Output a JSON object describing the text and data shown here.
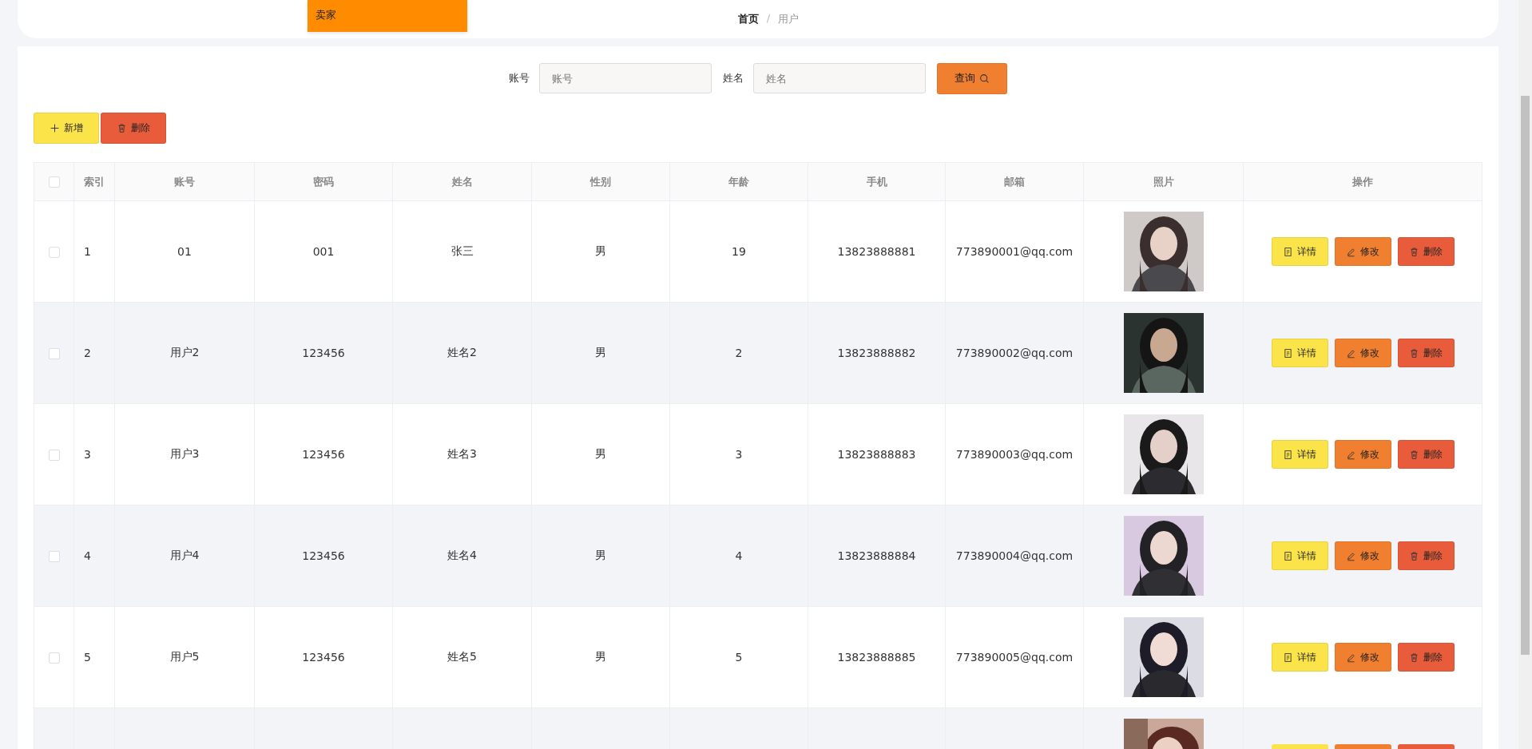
{
  "header": {
    "role_menu": {
      "label": "卖家"
    },
    "breadcrumb": [
      {
        "label": "首页",
        "current": false
      },
      {
        "label": "用户",
        "current": true
      }
    ],
    "separator": "/"
  },
  "search": {
    "fields": [
      {
        "label": "账号",
        "placeholder": "账号"
      },
      {
        "label": "姓名",
        "placeholder": "姓名"
      }
    ],
    "button": "查询"
  },
  "toolbar": [
    {
      "label": "新增",
      "kind": "add"
    },
    {
      "label": "删除",
      "kind": "delete"
    }
  ],
  "table": {
    "select_all": {
      "checked": false
    },
    "columns": [
      "索引",
      "账号",
      "密码",
      "姓名",
      "性别",
      "年龄",
      "手机",
      "邮箱",
      "照片",
      "操作"
    ],
    "rows": [
      {
        "checked": false,
        "cells": [
          "1",
          "01",
          "001",
          "张三",
          "男",
          "19",
          "13823888881",
          "773890001@qq.com"
        ],
        "actions": [
          {
            "label": "详情",
            "kind": "detail"
          },
          {
            "label": "修改",
            "kind": "edit"
          },
          {
            "label": "删除",
            "kind": "delete"
          }
        ]
      },
      {
        "checked": false,
        "cells": [
          "2",
          "用户2",
          "123456",
          "姓名2",
          "男",
          "2",
          "13823888882",
          "773890002@qq.com"
        ],
        "actions": [
          {
            "label": "详情",
            "kind": "detail"
          },
          {
            "label": "修改",
            "kind": "edit"
          },
          {
            "label": "删除",
            "kind": "delete"
          }
        ]
      },
      {
        "checked": false,
        "cells": [
          "3",
          "用户3",
          "123456",
          "姓名3",
          "男",
          "3",
          "13823888883",
          "773890003@qq.com"
        ],
        "actions": [
          {
            "label": "详情",
            "kind": "detail"
          },
          {
            "label": "修改",
            "kind": "edit"
          },
          {
            "label": "删除",
            "kind": "delete"
          }
        ]
      },
      {
        "checked": false,
        "cells": [
          "4",
          "用户4",
          "123456",
          "姓名4",
          "男",
          "4",
          "13823888884",
          "773890004@qq.com"
        ],
        "actions": [
          {
            "label": "详情",
            "kind": "detail"
          },
          {
            "label": "修改",
            "kind": "edit"
          },
          {
            "label": "删除",
            "kind": "delete"
          }
        ]
      },
      {
        "checked": false,
        "cells": [
          "5",
          "用户5",
          "123456",
          "姓名5",
          "男",
          "5",
          "13823888885",
          "773890005@qq.com"
        ],
        "actions": [
          {
            "label": "详情",
            "kind": "detail"
          },
          {
            "label": "修改",
            "kind": "edit"
          },
          {
            "label": "删除",
            "kind": "delete"
          }
        ]
      }
    ],
    "partial_row": {
      "actions": [
        {
          "kind": "detail"
        },
        {
          "kind": "edit"
        },
        {
          "kind": "delete"
        }
      ]
    }
  }
}
